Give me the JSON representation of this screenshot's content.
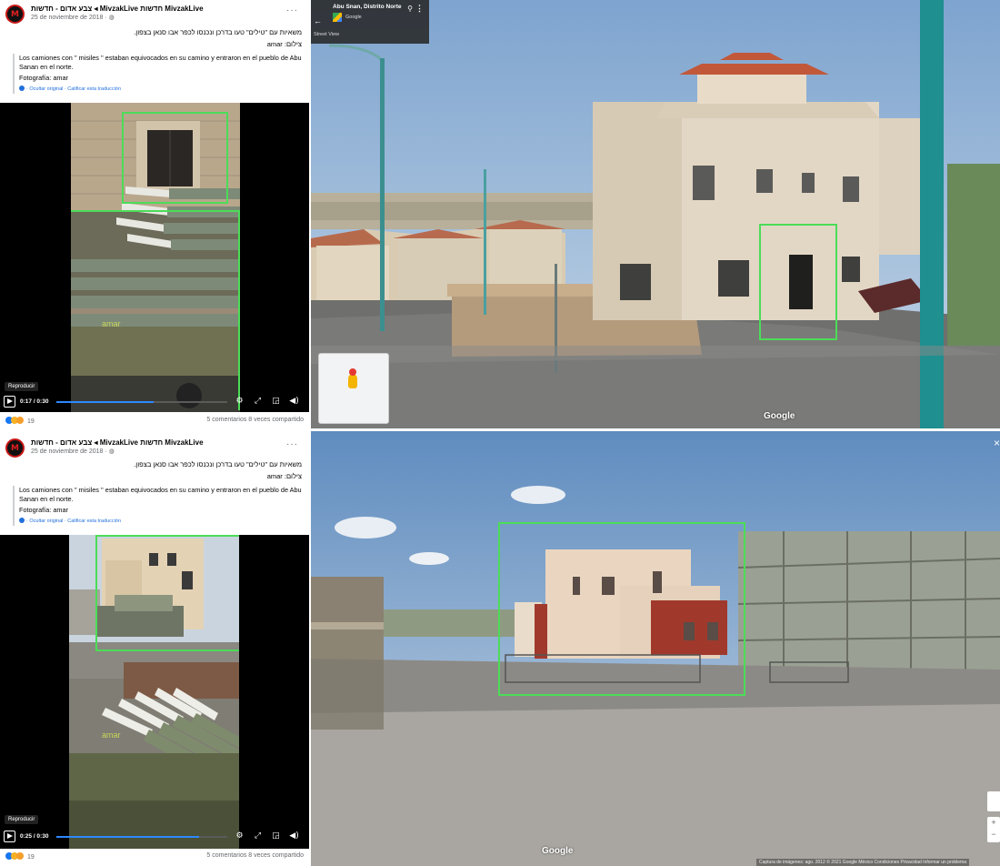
{
  "post": {
    "author": "צבע אדום - חדשות ◂ MivzakLive חדשות MivzakLive",
    "avatar_text": "M",
    "date": "25 de noviembre de 2018 · ",
    "more": "···",
    "hebrew_line1": "משאיות עם \"טילים\" טעו בדרכן ונכנסו לכפר אבו סנאן בצפון.",
    "hebrew_line2": "צילום: amar",
    "translation": "Los camiones con '' misiles '' estaban equivocados en su camino y entraron en el pueblo de Abu Sanan en el norte.",
    "translation_credit": "Fotografía: amar",
    "translation_links": "· Ocultar original · Calificar esta traducción",
    "reactions_count": "19",
    "comments_shares": "5 comentarios  8 veces compartido",
    "video_label": "Reproducir",
    "watermark": "amar"
  },
  "videos": [
    {
      "time": "0:17 / 0:30",
      "progress": 0.567
    },
    {
      "time": "0:25 / 0:30",
      "progress": 0.833
    }
  ],
  "streetview": {
    "location": "Abu Snan, Distrito Norte",
    "provider": "Google",
    "mode": "Street View",
    "back_icon": "arrow-left-icon",
    "watermark": "Google",
    "credits": "Captura de imágenes: ago. 2012   © 2021 Google   México   Condiciones   Privacidad   Informar un problema",
    "close": "×",
    "zoom_in": "+",
    "zoom_out": "−"
  },
  "colors": {
    "highlight": "#4cdc58",
    "fb_link": "#216fdb",
    "progress": "#2d88ff"
  }
}
